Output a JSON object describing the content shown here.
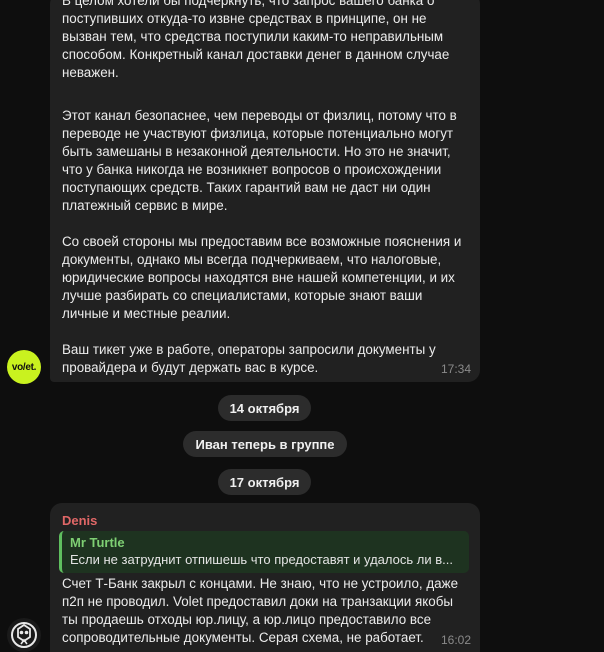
{
  "messages": [
    {
      "paragraphs": [
        "В целом хотели бы подчеркнуть, что запрос вашего банка о поступивших откуда-то извне средствах в принципе, он не вызван тем, что средства поступили каким-то неправильным способом. Конкретный канал доставки денег в данном случае неважен.",
        "Этот канал безопаснее, чем переводы от физлиц, потому что в переводе не участвуют физлица, которые потенциально могут быть замешаны в незаконной деятельности. Но это не значит, что у банка никогда не возникнет вопросов о происхождении поступающих средств. Таких гарантий вам не даст ни один платежный сервис в мире.",
        "Со своей стороны мы предоставим все возможные пояснения и документы, однако мы всегда подчеркиваем, что налоговые, юридические вопросы находятся вне нашей компетенции, и их лучше разбирать со специалистами, которые знают ваши личные и местные реалии.",
        "Ваш тикет уже в работе, операторы запросили документы у провайдера и будут держать вас в курсе."
      ],
      "time": "17:34",
      "avatar_text": "vo/et."
    },
    {
      "sender": "Denis",
      "reply_to": {
        "name": "Mr Turtle",
        "text": "Если не затруднит отпишешь что предоставят и удалось ли в..."
      },
      "text": "Счет Т-Банк закрыл с концами. Не знаю, что не устроило, даже п2п не проводил. Volet предоставил доки на транзакции якобы ты продаешь отходы юр.лицу, а юр.лицо предоставило все сопроводительные документы. Серая схема, не работает.",
      "time": "16:02"
    }
  ],
  "service": {
    "date1": "14 октября",
    "join": "Иван теперь в группе",
    "date2": "17 октября"
  },
  "colors": {
    "background": "#0e0e0e",
    "bubble": "#212121",
    "volet_accent": "#c9f21f",
    "sender_name": "#e06767",
    "reply_accent": "#5fbf5f"
  }
}
